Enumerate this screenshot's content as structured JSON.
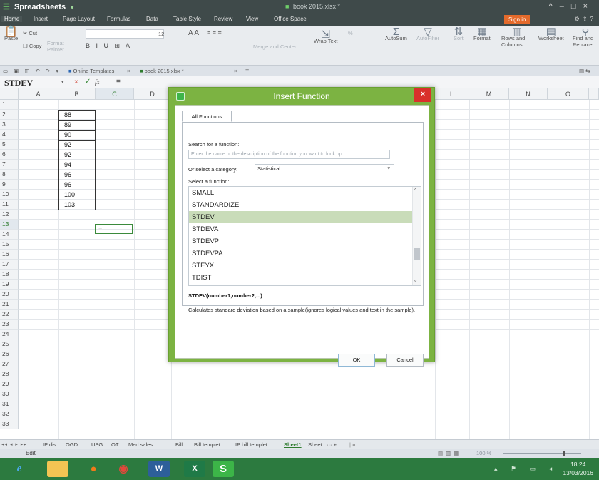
{
  "app": {
    "name": "Spreadsheets",
    "document_title": "book 2015.xlsx *"
  },
  "menu": {
    "tabs": [
      "Home",
      "Insert",
      "Page Layout",
      "Formulas",
      "Data",
      "Table Style",
      "Review",
      "View",
      "Office Space"
    ],
    "sign_in": "Sign in"
  },
  "ribbon": {
    "cut": "Cut",
    "paste": "Paste",
    "copy": "Copy",
    "format_painter": "Format Painter",
    "font_size": "12",
    "merge_center": "Merge and Center",
    "wrap_text": "Wrap Text",
    "autosum": "AutoSum",
    "autofilter": "AutoFilter",
    "sort": "Sort",
    "format": "Format",
    "rows_columns": "Rows and Columns",
    "worksheet": "Worksheet",
    "find_replace": "Find and Replace",
    "percent": "%"
  },
  "doc_tabs": {
    "online_templates": "Online Templates",
    "book": "book 2015.xlsx *"
  },
  "formula_bar": {
    "name_box": "STDEV",
    "content": "="
  },
  "columns": [
    "A",
    "B",
    "C",
    "D",
    "L",
    "M",
    "N",
    "O"
  ],
  "rows": [
    "1",
    "2",
    "3",
    "4",
    "5",
    "6",
    "7",
    "8",
    "9",
    "10",
    "11",
    "12",
    "13",
    "14",
    "15",
    "16",
    "17",
    "18",
    "19",
    "20",
    "21",
    "22",
    "23",
    "24",
    "25",
    "26",
    "27",
    "28",
    "29",
    "30",
    "31",
    "32",
    "33"
  ],
  "column_b_values": [
    "88",
    "89",
    "90",
    "92",
    "92",
    "94",
    "96",
    "96",
    "100",
    "103"
  ],
  "active_cell_value": "=",
  "sheet_tabs": [
    "IP dis",
    "OGD",
    "USG",
    "OT",
    "Med sales",
    "Bill",
    "Bill templet",
    "IP bill templet",
    "Sheet1",
    "Sheet"
  ],
  "active_sheet": "Sheet1",
  "status": {
    "mode": "Edit",
    "zoom": "100 %"
  },
  "clock": {
    "time": "18:24",
    "date": "13/03/2016"
  },
  "dialog": {
    "title": "Insert Function",
    "tab": "All Functions",
    "search_label": "Search for a function:",
    "search_placeholder": "Enter the name or the description of the function you want to look up.",
    "category_label": "Or select a category:",
    "category_value": "Statistical",
    "select_label": "Select a function:",
    "functions": [
      "SMALL",
      "STANDARDIZE",
      "STDEV",
      "STDEVA",
      "STDEVP",
      "STDEVPA",
      "STEYX",
      "TDIST"
    ],
    "selected_function": "STDEV",
    "signature": "STDEV(number1,number2,...)",
    "description": "Calculates standard deviation based on a sample(ignores logical values and text in the sample).",
    "ok": "OK",
    "cancel": "Cancel"
  }
}
